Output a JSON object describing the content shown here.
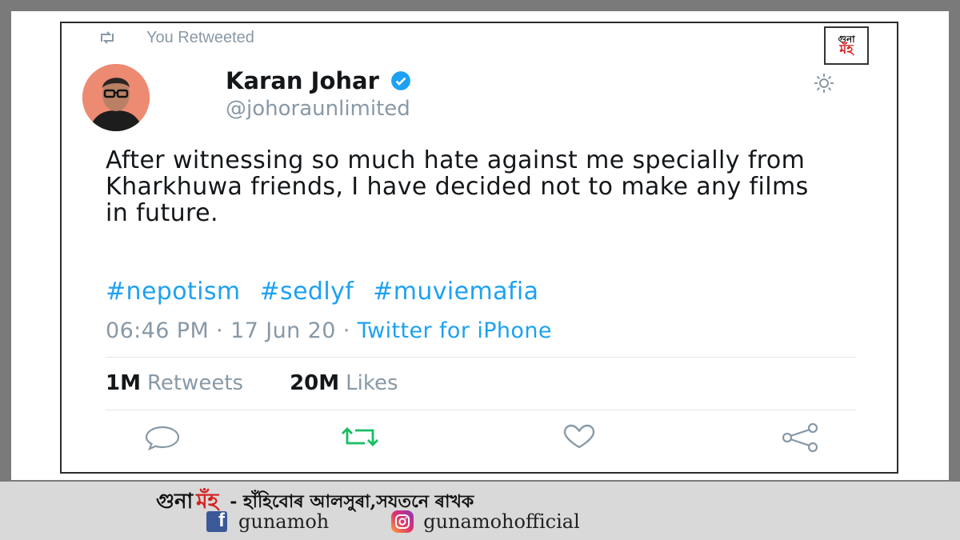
{
  "retweet_label": "You Retweeted",
  "logo_badge": {
    "line1": "গুনা",
    "line2": "মঁহ"
  },
  "author": {
    "name": "Karan Johar",
    "handle": "@johoraunlimited"
  },
  "tweet": {
    "text": "After witnessing so much hate against me specially from Kharkhuwa friends, I have decided not to make any films in future.",
    "hashtags": [
      "#nepotism",
      "#sedlyf",
      "#muviemafia"
    ]
  },
  "meta": {
    "time": "06:46 PM",
    "separator": "·",
    "date": "17 Jun 20",
    "source": "Twitter for iPhone"
  },
  "stats": {
    "retweets_count": "1M",
    "retweets_label": "Retweets",
    "likes_count": "20M",
    "likes_label": "Likes"
  },
  "icons": [
    "retweet-icon",
    "verified-badge-icon",
    "gear-icon",
    "reply-icon",
    "retweet-action-icon",
    "like-icon",
    "share-icon",
    "facebook-icon",
    "instagram-icon"
  ],
  "colors": {
    "accent": "#1da1f2",
    "retweeted": "#17bf63",
    "muted": "#8899a6",
    "brand_red": "#d62020"
  },
  "footer": {
    "brand_part1": "গুনা",
    "brand_part2": "মঁহ",
    "tagline": "- হাঁহিবোৰ আলসুৰা,সযতনে ৰাখক",
    "facebook_handle": "gunamoh",
    "instagram_handle": "gunamohofficial"
  }
}
